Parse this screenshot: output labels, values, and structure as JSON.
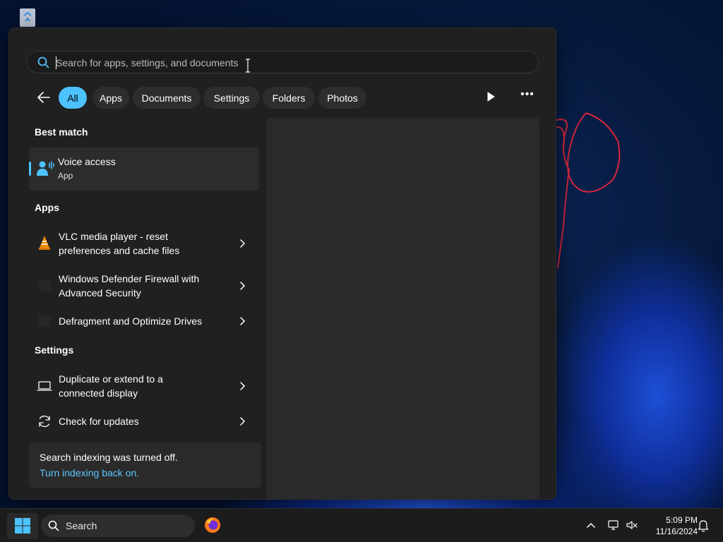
{
  "search": {
    "placeholder": "Search for apps, settings, and documents",
    "value": ""
  },
  "filters": {
    "chips": [
      {
        "label": "All",
        "active": true
      },
      {
        "label": "Apps",
        "active": false
      },
      {
        "label": "Documents",
        "active": false
      },
      {
        "label": "Settings",
        "active": false
      },
      {
        "label": "Folders",
        "active": false
      },
      {
        "label": "Photos",
        "active": false
      }
    ]
  },
  "sections": {
    "best_match": "Best match",
    "apps": "Apps",
    "settings": "Settings"
  },
  "best_match": {
    "name": "Voice access",
    "type": "App",
    "icon": "voice-access-icon"
  },
  "apps": [
    {
      "line1": "VLC media player - reset",
      "line2": "preferences and cache files",
      "icon": "vlc-cone-icon"
    },
    {
      "line1": "Windows Defender Firewall with",
      "line2": "Advanced Security",
      "icon": "firewall-icon"
    },
    {
      "line1": "Defragment and Optimize Drives",
      "line2": "",
      "icon": "defrag-icon"
    }
  ],
  "settings_items": [
    {
      "line1": "Duplicate or extend to a",
      "line2": "connected display",
      "icon": "laptop-display-icon"
    },
    {
      "line1": "Check for updates",
      "line2": "",
      "icon": "refresh-icon"
    }
  ],
  "index_note": {
    "message": "Search indexing was turned off.",
    "link": "Turn indexing back on."
  },
  "taskbar": {
    "search_label": "Search",
    "time": "5:09 PM",
    "date": "11/16/2024"
  },
  "colors": {
    "accent": "#4cc2ff",
    "link": "#60c6ff",
    "panel": "#202020"
  }
}
